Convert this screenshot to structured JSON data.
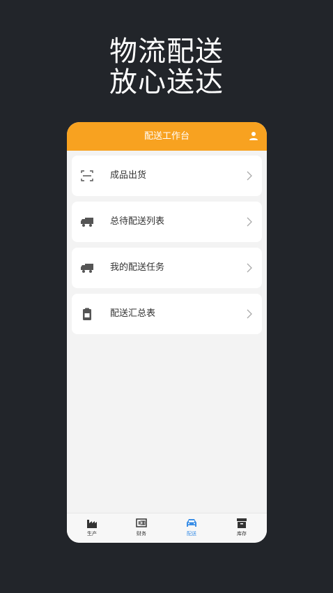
{
  "promo": {
    "line1": "物流配送",
    "line2": "放心送达"
  },
  "header": {
    "title": "配送工作台"
  },
  "menu": [
    {
      "label": "成品出货",
      "icon": "scan-icon"
    },
    {
      "label": "总待配送列表",
      "icon": "truck-icon"
    },
    {
      "label": "我的配送任务",
      "icon": "truck-icon"
    },
    {
      "label": "配送汇总表",
      "icon": "clipboard-icon"
    }
  ],
  "tabs": [
    {
      "label": "生产",
      "icon": "factory-icon",
      "active": false
    },
    {
      "label": "财务",
      "icon": "finance-icon",
      "active": false
    },
    {
      "label": "配送",
      "icon": "car-icon",
      "active": true
    },
    {
      "label": "库存",
      "icon": "box-icon",
      "active": false
    }
  ],
  "colors": {
    "accent": "#f8a220",
    "active_tab": "#3a8ee6",
    "background": "#22252a"
  }
}
